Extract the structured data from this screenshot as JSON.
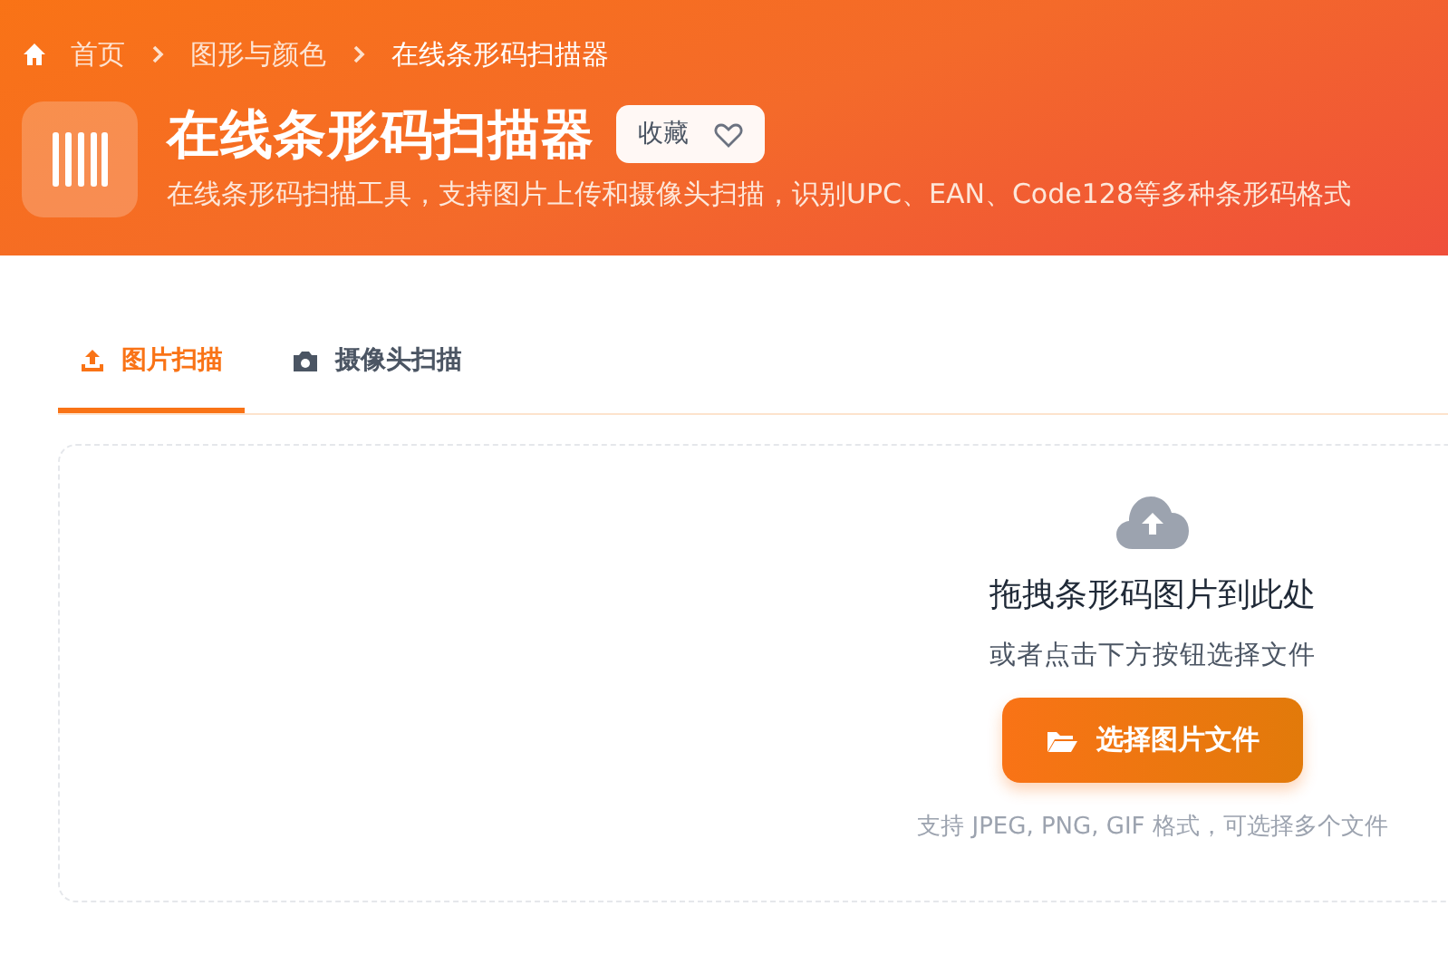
{
  "breadcrumb": [
    {
      "label": "首页"
    },
    {
      "label": "图形与颜色"
    },
    {
      "label": "在线条形码扫描器"
    }
  ],
  "title": "在线条形码扫描器",
  "favorite": {
    "label": "收藏",
    "on": false
  },
  "description": "在线条形码扫描工具，支持图片上传和摄像头扫描，识别UPC、EAN、Code128等多种条形码格式",
  "tabs": [
    {
      "label": "图片扫描",
      "kind": "upload",
      "selected": true
    },
    {
      "label": "摄像头扫描",
      "kind": "camera",
      "selected": false
    }
  ],
  "dropzone": {
    "title": "拖拽条形码图片到此处",
    "subtitle": "或者点击下方按钮选择文件",
    "button": "选择图片文件",
    "hint": "支持 JPEG, PNG, GIF 格式，可选择多个文件"
  }
}
